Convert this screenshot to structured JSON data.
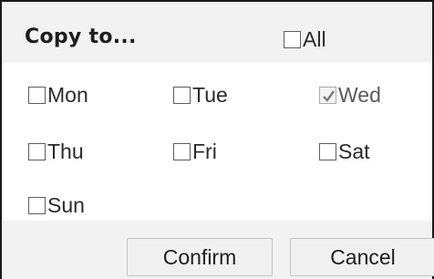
{
  "dialog": {
    "title": "Copy to...",
    "all": {
      "label": "All",
      "checked": false
    },
    "days": [
      {
        "label": "Mon",
        "checked": false,
        "disabled": false
      },
      {
        "label": "Tue",
        "checked": false,
        "disabled": false
      },
      {
        "label": "Wed",
        "checked": true,
        "disabled": true
      },
      {
        "label": "Thu",
        "checked": false,
        "disabled": false
      },
      {
        "label": "Fri",
        "checked": false,
        "disabled": false
      },
      {
        "label": "Sat",
        "checked": false,
        "disabled": false
      },
      {
        "label": "Sun",
        "checked": false,
        "disabled": false
      }
    ],
    "buttons": {
      "confirm_label": "Confirm",
      "cancel_label": "Cancel"
    },
    "colors": {
      "header_bg": "#f2f2f2",
      "border": "#1a1a1a",
      "checkmark": "#7a7a7a"
    }
  }
}
